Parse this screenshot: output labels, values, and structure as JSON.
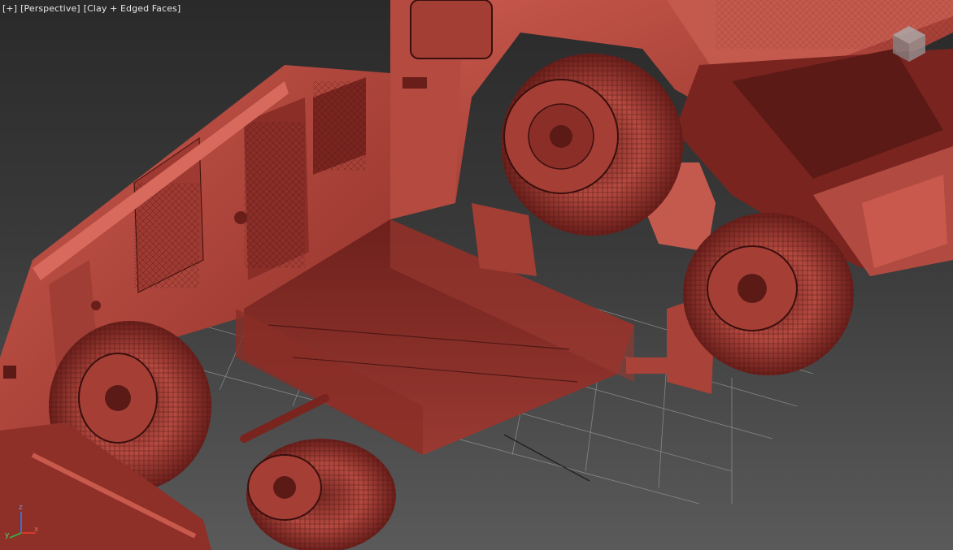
{
  "viewport": {
    "label_plus": "[+]",
    "label_view": "[Perspective]",
    "label_shading": "[Clay + Edged Faces]"
  },
  "scene": {
    "object": "fire truck model",
    "material_color": "#b5493f",
    "material_dark": "#5c1a17",
    "grid_color": "#9a9a9a",
    "background_top": "#2a2a2a",
    "background_bottom": "#5a5a5a"
  },
  "viewcube": {
    "icon": "viewcube-icon"
  },
  "axis_gizmo": {
    "x": "x",
    "y": "y",
    "z": "z",
    "x_color": "#d23a2a",
    "y_color": "#3aa845",
    "z_color": "#3a6fd0"
  }
}
